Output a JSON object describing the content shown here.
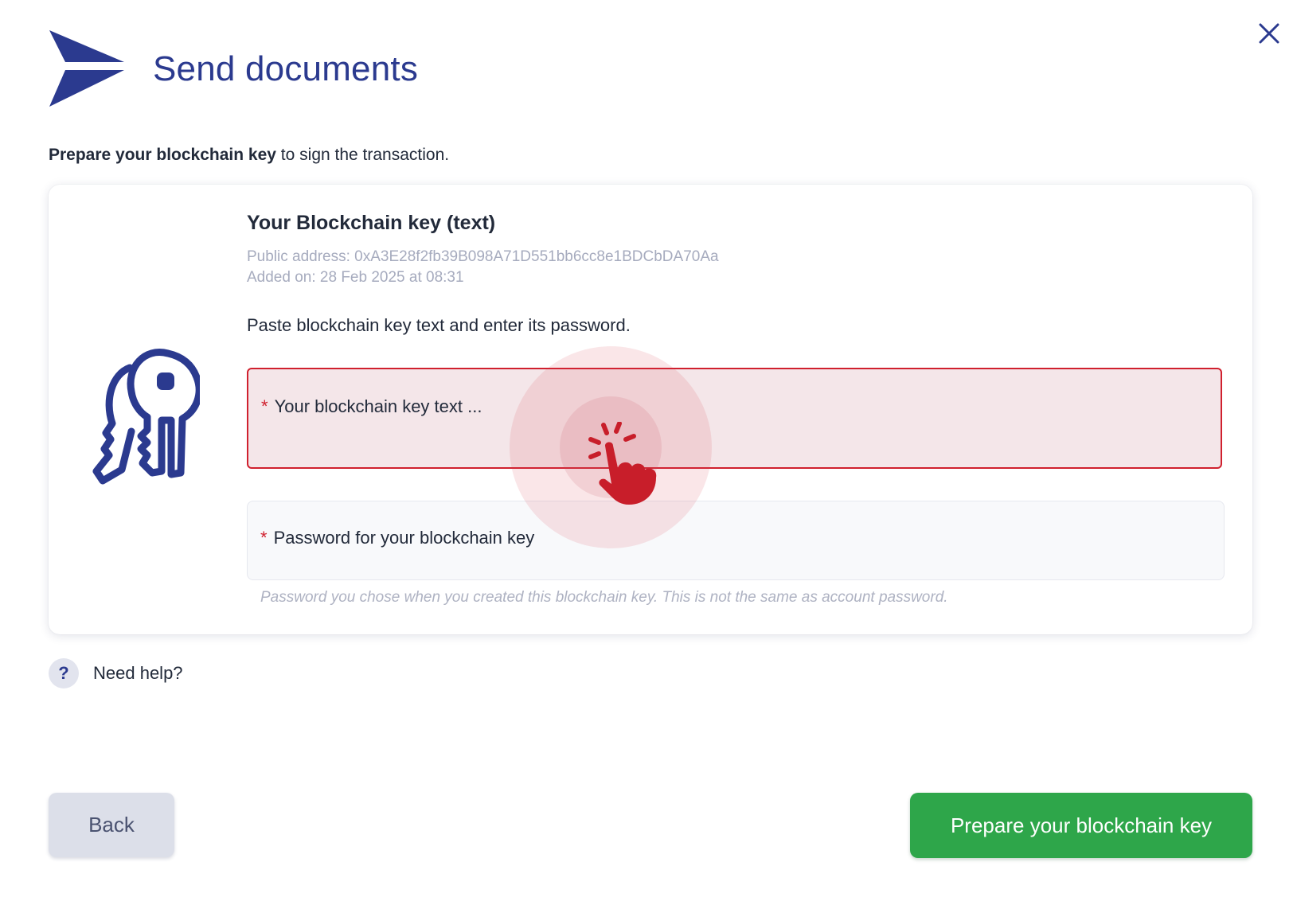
{
  "header": {
    "title": "Send documents",
    "logo_icon": "paper-plane-icon",
    "close_icon": "close-icon"
  },
  "intro": {
    "bold": "Prepare your blockchain key",
    "rest": " to sign the transaction."
  },
  "card": {
    "icon": "keys-icon",
    "title": "Your Blockchain key (text)",
    "public_address": "Public address: 0xA3E28f2fb39B098A71D551bb6cc8e1BDCbDA70Aa",
    "added_on": "Added on: 28 Feb 2025 at 08:31",
    "instruction": "Paste blockchain key text and enter its password.",
    "key_field": {
      "required_mark": "*",
      "placeholder": "Your blockchain key text ...",
      "value": ""
    },
    "password_field": {
      "required_mark": "*",
      "placeholder": "Password for your blockchain key",
      "value": ""
    },
    "password_hint": "Password you chose when you created this blockchain key. This is not the same as account password."
  },
  "help": {
    "icon": "question-mark-icon",
    "glyph": "?",
    "label": "Need help?"
  },
  "footer": {
    "back_label": "Back",
    "primary_label": "Prepare your blockchain key"
  },
  "colors": {
    "brand_blue": "#2b3a8f",
    "error_red": "#d0202e",
    "primary_green": "#2ea64a"
  }
}
